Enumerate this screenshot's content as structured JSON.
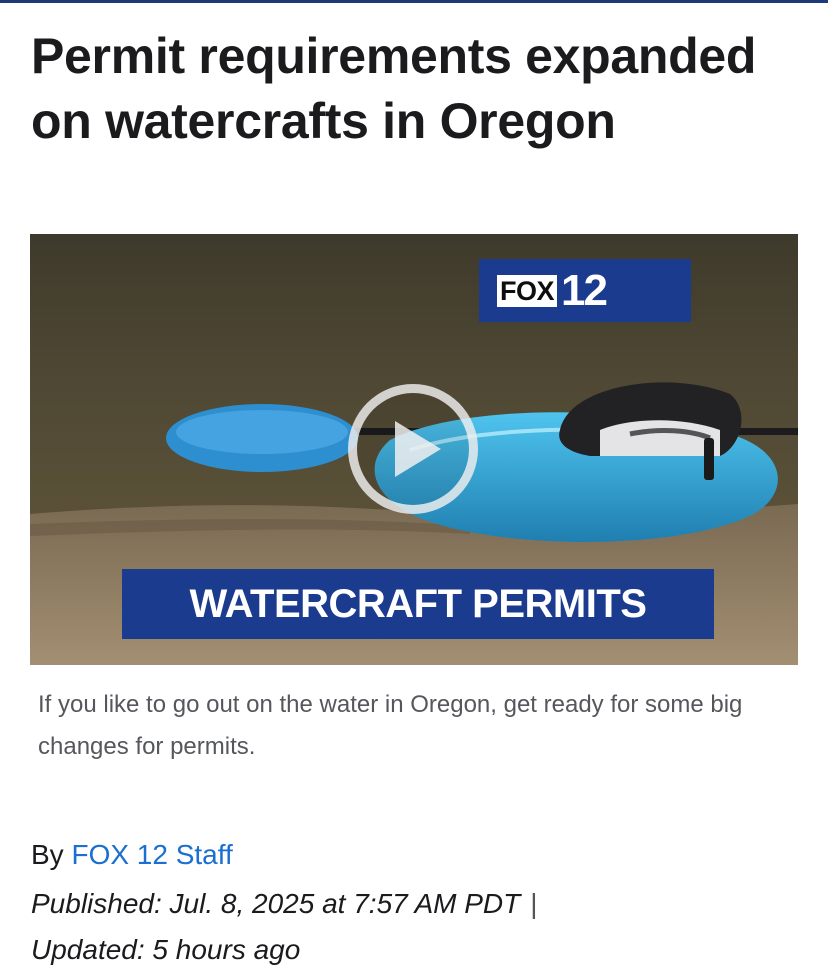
{
  "article": {
    "headline": "Permit requirements expanded on watercrafts in Oregon",
    "caption": "If you like to go out on the water in Oregon, get ready for some big changes for permits.",
    "byline_prefix": "By",
    "author": "FOX 12 Staff",
    "published": "Published: Jul. 8, 2025 at 7:57 AM PDT",
    "separator": "|",
    "updated": "Updated: 5 hours ago"
  },
  "video": {
    "logo_fox": "FOX",
    "logo_num": "12",
    "banner": "WATERCRAFT PERMITS",
    "play_icon": "play-icon"
  },
  "colors": {
    "brand_blue": "#1b3b8e",
    "link": "#1a6fd0",
    "kayak": "#2aa3d6"
  }
}
